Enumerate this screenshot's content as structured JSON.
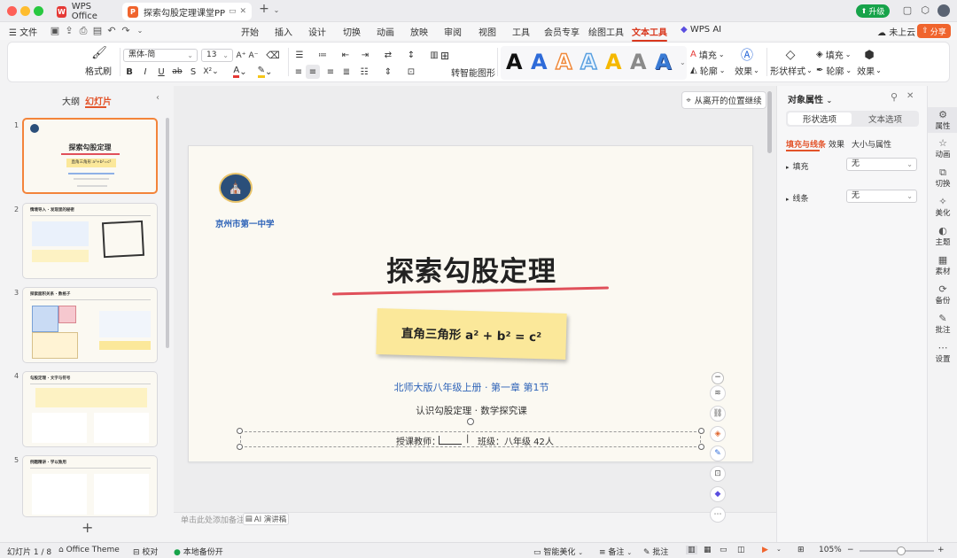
{
  "titlebar": {
    "tabs": [
      {
        "label": "WPS Office",
        "icon": "wps-logo-icon"
      },
      {
        "label": "探索勾股定理课堂PPT.ppt",
        "icon": "ppt-file-icon"
      }
    ],
    "upgrade_label": "升级"
  },
  "menubar": {
    "file_label": "文件",
    "items": [
      "开始",
      "插入",
      "设计",
      "切换",
      "动画",
      "放映",
      "审阅",
      "视图",
      "工具",
      "会员专享",
      "绘图工具",
      "文本工具",
      "WPS AI"
    ],
    "active": "文本工具",
    "cloud_label": "未上云",
    "share_label": "分享"
  },
  "ribbon": {
    "format_painter": "格式刷",
    "font_name": "黑体-简",
    "font_size": "13",
    "smart_shape": "转智能图形",
    "fill_label": "填充",
    "outline_label": "轮廓",
    "effect_label": "效果",
    "shape_style_label": "形状样式",
    "shape_fill_label": "填充",
    "shape_outline_label": "轮廓",
    "shape_effect_label": "效果",
    "wordart_letter": "A",
    "colors": {
      "red": "#e53935",
      "yellow": "#f5c518"
    }
  },
  "leftpane": {
    "tab_outline": "大纲",
    "tab_slides": "幻灯片",
    "thumbs": [
      {
        "num": "1",
        "title": "探索勾股定理",
        "sub": "直角三角形  a²+b²=c²"
      },
      {
        "num": "2",
        "title": "情境导入 · 发现里的秘密"
      },
      {
        "num": "3",
        "title": "探索面积关系 · 数格子"
      },
      {
        "num": "4",
        "title": "勾股定理 · 文字与符号"
      },
      {
        "num": "5",
        "title": "例题精讲 · 学以致用"
      }
    ]
  },
  "slide": {
    "school": "京州市第一中学",
    "title": "探索勾股定理",
    "formula": "直角三角形  a² + b² = c²",
    "edition": "北师大版八年级上册 · 第一章 第1节",
    "subtitle": "认识勾股定理 · 数学探究课",
    "teacher_line": "授课教师：",
    "class_line": "班级：八年级  42人",
    "divider": "|"
  },
  "canvas": {
    "continue_label": "从离开的位置继续",
    "notes_placeholder": "单击此处添加备注",
    "ai_notes": "AI 演讲稿"
  },
  "rightpane": {
    "title": "对象属性",
    "tab_shape": "形状选项",
    "tab_text": "文本选项",
    "subtabs": [
      "填充与线条",
      "效果",
      "大小与属性"
    ],
    "fill_label": "填充",
    "fill_value": "无",
    "line_label": "线条",
    "line_value": "无"
  },
  "sidebar": {
    "items": [
      "属性",
      "动画",
      "切换",
      "美化",
      "主题",
      "素材",
      "备份",
      "批注",
      "设置"
    ]
  },
  "statusbar": {
    "slide_count": "幻灯片 1 / 8",
    "theme": "Office Theme",
    "proof": "校对",
    "backup": "本地备份开",
    "beautify": "智能美化",
    "notes": "备注",
    "comment": "批注",
    "zoom": "105%"
  }
}
